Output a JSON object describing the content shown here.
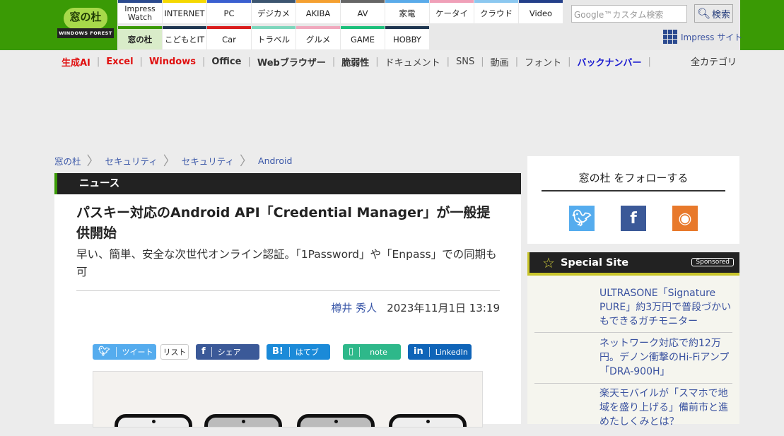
{
  "header": {
    "logo_text": "窓の杜",
    "logo_sub": "WINDOWS FOREST",
    "tabs_row1": [
      {
        "label": "Impress Watch",
        "color": "#2b4a8f"
      },
      {
        "label": "INTERNET",
        "color": "#f5d800"
      },
      {
        "label": "PC",
        "color": "#3a5fd0"
      },
      {
        "label": "デジカメ",
        "color": "#3c5570"
      },
      {
        "label": "AKIBA",
        "color": "#f5a030"
      },
      {
        "label": "AV",
        "color": "#666666"
      },
      {
        "label": "家電",
        "color": "#5aabea"
      },
      {
        "label": "ケータイ",
        "color": "#f0a0b8"
      },
      {
        "label": "クラウド",
        "color": "#8cc8f0"
      },
      {
        "label": "Video",
        "color": "#233f8a"
      }
    ],
    "tabs_row2": [
      {
        "label": "窓の杜",
        "color": "#3a9a05"
      },
      {
        "label": "こどもとIT",
        "color": "#1e3650"
      },
      {
        "label": "Car",
        "color": "#d91c1c"
      },
      {
        "label": "トラベル",
        "color": "#7dd6bc"
      },
      {
        "label": "グルメ",
        "color": "#f0a8bd"
      },
      {
        "label": "GAME",
        "color": "#1bbf7a"
      },
      {
        "label": "HOBBY",
        "color": "#1e3650"
      }
    ],
    "search_placeholder": "Google™カスタム検索",
    "search_button": "検索",
    "impress_site": "Impress サイト"
  },
  "nav": {
    "items": [
      {
        "label": "生成AI",
        "color": "#e01010",
        "bold": true
      },
      {
        "label": "Excel",
        "color": "#e01010",
        "bold": true
      },
      {
        "label": "Windows",
        "color": "#e01010",
        "bold": true
      },
      {
        "label": "Office",
        "color": "#333333",
        "bold": true
      },
      {
        "label": "Webブラウザー",
        "color": "#333333",
        "bold": true
      },
      {
        "label": "脆弱性",
        "color": "#333333",
        "bold": true
      },
      {
        "label": "ドキュメント",
        "color": "#444444",
        "bold": false
      },
      {
        "label": "SNS",
        "color": "#444444",
        "bold": false
      },
      {
        "label": "動画",
        "color": "#444444",
        "bold": false
      },
      {
        "label": "フォント",
        "color": "#444444",
        "bold": false
      },
      {
        "label": "バックナンバー",
        "color": "#1a1ad0",
        "bold": true
      }
    ],
    "all_categories": "全カテゴリ"
  },
  "breadcrumb": [
    "窓の杜",
    "セキュリティ",
    "セキュリティ",
    "Android"
  ],
  "article": {
    "section": "ニュース",
    "title": "パスキー対応のAndroid API「Credential Manager」が一般提供開始",
    "subtitle": "早い、簡単、安全な次世代オンライン認証。「1Password」や「Enpass」での同期も可",
    "author": "樽井 秀人",
    "date": "2023年11月1日 13:19",
    "share": {
      "tweet": "ツイート",
      "list": "リスト",
      "facebook": "シェア",
      "hatena": "はてブ",
      "note": "note",
      "linkedin": "LinkedIn"
    }
  },
  "sidebar": {
    "follow_title": "窓の杜 をフォローする",
    "special_title": "Special Site",
    "sponsored": "Sponsored",
    "special_items": [
      "ULTRASONE「Signature PURE」約3万円で普段づかいもできるガチモニター",
      "ネットワーク対応で約12万円。デノン衝撃のHi-Fiアンプ「DRA-900H」",
      "楽天モバイルが「スマホで地域を盛り上げる」備前市と進めたしくみとは？"
    ]
  }
}
